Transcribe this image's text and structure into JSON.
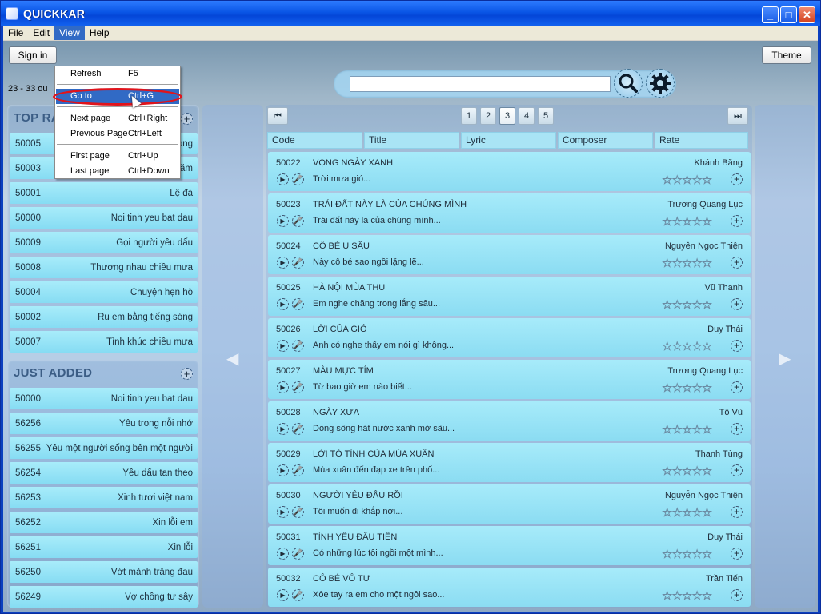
{
  "window": {
    "title": "QUICKKAR",
    "minimize": "_",
    "maximize": "□",
    "close": "✕"
  },
  "menubar": [
    "File",
    "Edit",
    "View",
    "Help"
  ],
  "view_menu": {
    "items": [
      {
        "label": "Refresh",
        "shortcut": "F5"
      },
      {
        "label": "Go to",
        "shortcut": "Ctrl+G",
        "highlighted": true
      },
      {
        "label": "Next page",
        "shortcut": "Ctrl+Right"
      },
      {
        "label": "Previous Page",
        "shortcut": "Ctrl+Left"
      },
      {
        "label": "First page",
        "shortcut": "Ctrl+Up"
      },
      {
        "label": "Last page",
        "shortcut": "Ctrl+Down"
      }
    ]
  },
  "header": {
    "sign_in": "Sign in",
    "range_text": "23 - 33 ou",
    "theme": "Theme",
    "search_value": ""
  },
  "top_panel": {
    "title": "TOP RA",
    "rows": [
      {
        "code": "50005",
        "title": "ong"
      },
      {
        "code": "50003",
        "title": "Sáu mươi năm"
      },
      {
        "code": "50001",
        "title": "Lệ đá"
      },
      {
        "code": "50000",
        "title": "Noi tinh yeu bat dau"
      },
      {
        "code": "50009",
        "title": "Gọi người yêu dấu"
      },
      {
        "code": "50008",
        "title": "Thương nhau chiều mưa"
      },
      {
        "code": "50004",
        "title": "Chuyện hẹn hò"
      },
      {
        "code": "50002",
        "title": "Ru em bằng tiếng sóng"
      },
      {
        "code": "50007",
        "title": "Tình khúc chiều mưa"
      }
    ]
  },
  "new_panel": {
    "title": "JUST ADDED",
    "rows": [
      {
        "code": "50000",
        "title": "Noi tinh yeu bat dau"
      },
      {
        "code": "56256",
        "title": "Yêu trong nỗi nhớ"
      },
      {
        "code": "56255",
        "title": "Yêu một người sống bên một người"
      },
      {
        "code": "56254",
        "title": "Yêu dấu tan theo"
      },
      {
        "code": "56253",
        "title": "Xinh tươi việt nam"
      },
      {
        "code": "56252",
        "title": "Xin lỗi em"
      },
      {
        "code": "56251",
        "title": "Xin lỗi"
      },
      {
        "code": "56250",
        "title": "Vớt mảnh trăng đau"
      },
      {
        "code": "56249",
        "title": "Vợ chồng tư sây"
      }
    ]
  },
  "pagination": {
    "first": "⏮",
    "last": "⏭",
    "pages": [
      "1",
      "2",
      "3",
      "4",
      "5"
    ],
    "current": 3
  },
  "nav_arrows": {
    "prev": "◀",
    "next": "▶"
  },
  "columns": [
    "Code",
    "Title",
    "Lyric",
    "Composer",
    "Rate"
  ],
  "songs": [
    {
      "code": "50022",
      "title": "VỌNG NGÀY XANH",
      "composer": "Khánh Băng",
      "lyric": "Trời mưa gió...",
      "rating": 0
    },
    {
      "code": "50023",
      "title": "TRÁI ĐẤT NÀY LÀ CỦA CHÚNG MÌNH",
      "composer": "Trương Quang Lục",
      "lyric": "Trái đất này là của chúng mình...",
      "rating": 0
    },
    {
      "code": "50024",
      "title": "CÔ BÉ U SẦU",
      "composer": "Nguyễn Ngọc Thiện",
      "lyric": "Này cô bé sao ngồi lặng lẽ...",
      "rating": 0
    },
    {
      "code": "50025",
      "title": "HÀ NỘI MÙA THU",
      "composer": "Vũ Thanh",
      "lyric": "Em nghe chăng trong lắng sâu...",
      "rating": 0
    },
    {
      "code": "50026",
      "title": "LỜI CỦA GIÓ",
      "composer": "Duy Thái",
      "lyric": "Anh có nghe thấy em nói gì không...",
      "rating": 0
    },
    {
      "code": "50027",
      "title": "MÀU MỰC TÍM",
      "composer": "Trương Quang Lục",
      "lyric": "Từ bao giờ em nào biết...",
      "rating": 0
    },
    {
      "code": "50028",
      "title": "NGÀY XƯA",
      "composer": "Tô Vũ",
      "lyric": "Dòng sông hát nước xanh mờ sâu...",
      "rating": 0
    },
    {
      "code": "50029",
      "title": "LỜI TỎ TÌNH CỦA MÙA XUÂN",
      "composer": "Thanh Tùng",
      "lyric": "Mùa xuân đến đạp xe trên phố...",
      "rating": 0
    },
    {
      "code": "50030",
      "title": "NGƯỜI YÊU ĐÂU RỒI",
      "composer": "Nguyễn Ngọc Thiện",
      "lyric": "Tôi muốn đi khắp nơi...",
      "rating": 0
    },
    {
      "code": "50031",
      "title": "TÌNH YÊU ĐẦU TIÊN",
      "composer": "Duy Thái",
      "lyric": "Có những lúc tôi ngồi một mình...",
      "rating": 0
    },
    {
      "code": "50032",
      "title": "CÔ BÉ VÔ TƯ",
      "composer": "Trần Tiến",
      "lyric": "Xòe tay ra em cho một ngôi sao...",
      "rating": 0
    }
  ],
  "card_icons": {
    "play": "▶",
    "mic": "🎤",
    "add": "+",
    "stars": "☆☆☆☆☆"
  },
  "colors": {
    "accent": "#316ac5",
    "card": "#8bdcf2",
    "ring": "#e0141c"
  }
}
